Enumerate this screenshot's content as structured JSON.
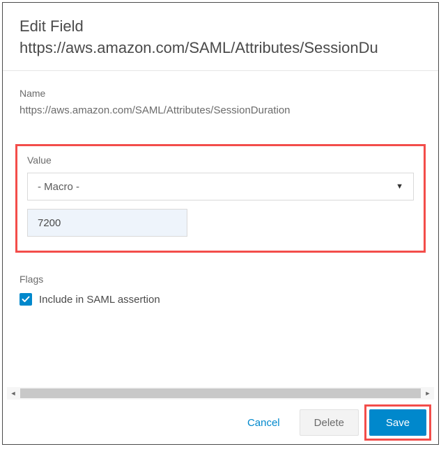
{
  "header": {
    "title": "Edit Field",
    "subtitle": "https://aws.amazon.com/SAML/Attributes/SessionDu"
  },
  "name": {
    "label": "Name",
    "value": "https://aws.amazon.com/SAML/Attributes/SessionDuration"
  },
  "value_section": {
    "label": "Value",
    "macro_placeholder": "- Macro -",
    "input_value": "7200"
  },
  "flags": {
    "label": "Flags",
    "checkbox_label": "Include in SAML assertion",
    "checked": true
  },
  "footer": {
    "cancel": "Cancel",
    "delete": "Delete",
    "save": "Save"
  },
  "colors": {
    "accent": "#0088cc",
    "highlight_border": "#f34d4a"
  }
}
